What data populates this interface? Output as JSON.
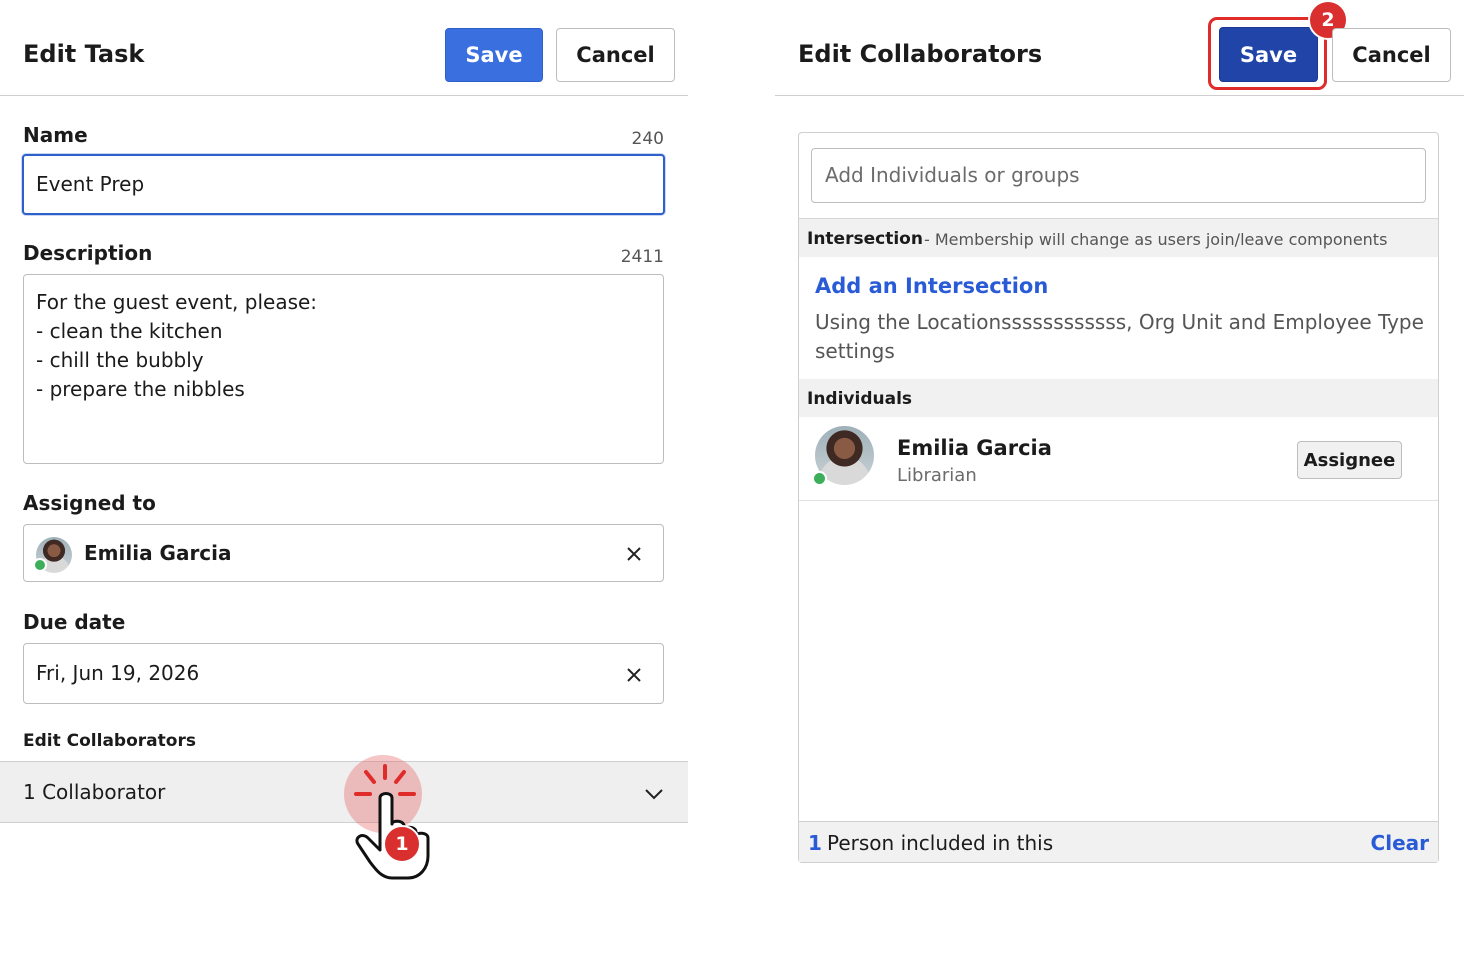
{
  "left": {
    "title": "Edit Task",
    "save_label": "Save",
    "cancel_label": "Cancel",
    "name_label": "Name",
    "name_counter": "240",
    "name_value": "Event Prep",
    "description_label": "Description",
    "description_counter": "2411",
    "description_value": "For the guest event, please:\n- clean the kitchen\n- chill the bubbly\n- prepare the nibbles",
    "assigned_label": "Assigned to",
    "assigned_name": "Emilia Garcia",
    "due_label": "Due date",
    "due_value": "Fri, Jun 19, 2026",
    "collab_label": "Edit Collaborators",
    "collab_value": "1 Collaborator"
  },
  "right": {
    "title": "Edit Collaborators",
    "save_label": "Save",
    "cancel_label": "Cancel",
    "search_placeholder": "Add Individuals or groups",
    "intersection_heading": "Intersection",
    "intersection_note": "- Membership will change as users join/leave components",
    "add_intersection": "Add an Intersection",
    "intersection_desc": "Using the Locationssssssssssss, Org Unit and Employee Type settings",
    "individuals_heading": "Individuals",
    "person_name": "Emilia Garcia",
    "person_role": "Librarian",
    "assignee_label": "Assignee",
    "footer_count": "1",
    "footer_text": "Person included in this",
    "clear_label": "Clear"
  },
  "annotations": {
    "step1": "1",
    "step2": "2"
  },
  "colors": {
    "primary": "#3a6fe0",
    "primary_dark": "#2144a8",
    "link": "#2a5bd7",
    "highlight_red": "#e02b2b",
    "presence_green": "#3dae5a"
  }
}
